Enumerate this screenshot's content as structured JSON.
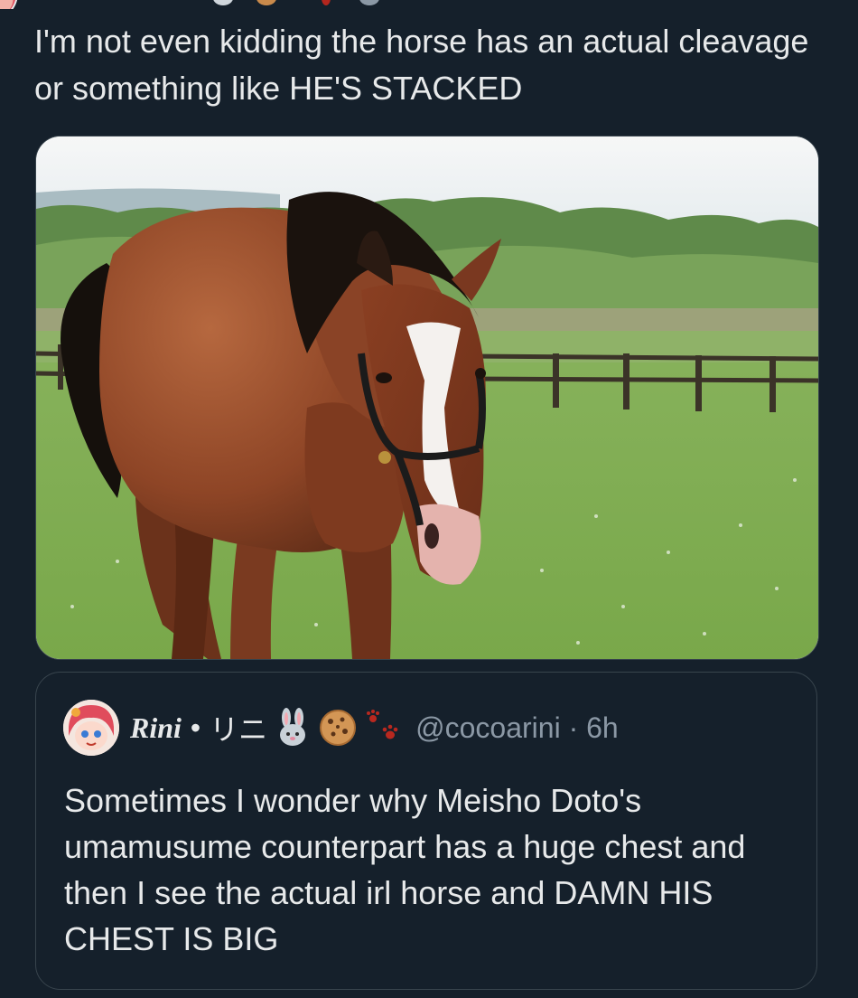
{
  "tweet": {
    "text": "I'm not even kidding the horse has an actual cleavage or something like HE'S STACKED"
  },
  "media": {
    "icon": "horse-photo"
  },
  "quote": {
    "display_name": "Rini",
    "separator": "•",
    "name_kana": "リニ",
    "emojis": [
      "rabbit-icon",
      "cookie-icon",
      "paw-prints-icon"
    ],
    "handle_time": "@cocoarini · 6h",
    "text": "Sometimes I wonder why Meisho Doto's umamusume counterpart has a huge chest and then I see the actual irl horse and DAMN HIS CHEST IS BIG"
  },
  "colors": {
    "background": "#15202b",
    "text": "#e7e9ea",
    "secondary_text": "#8b98a5",
    "border": "#38444d"
  }
}
